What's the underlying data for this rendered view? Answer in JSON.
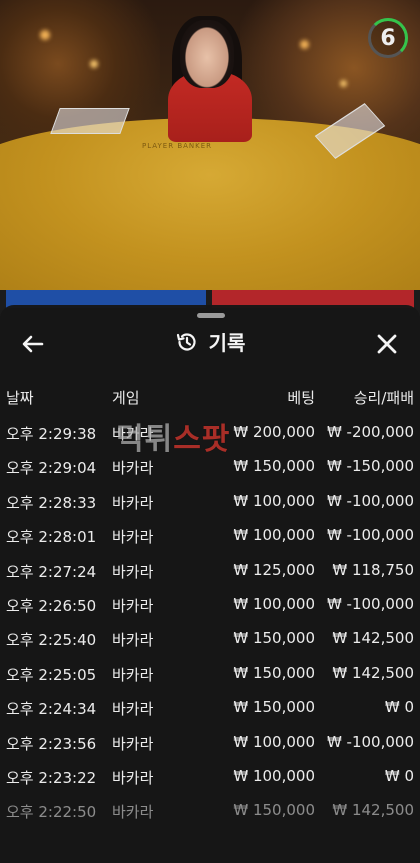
{
  "stream": {
    "countdown": "6",
    "table_labels": "PLAYER        BANKER"
  },
  "history": {
    "title": "기록",
    "columns": {
      "date": "날짜",
      "game": "게임",
      "bet": "베팅",
      "result": "승리/패배"
    },
    "rows": [
      {
        "time": "오후 2:29:38",
        "game": "바카라",
        "bet": "₩ 200,000",
        "result": "₩ -200,000"
      },
      {
        "time": "오후 2:29:04",
        "game": "바카라",
        "bet": "₩ 150,000",
        "result": "₩ -150,000"
      },
      {
        "time": "오후 2:28:33",
        "game": "바카라",
        "bet": "₩ 100,000",
        "result": "₩ -100,000"
      },
      {
        "time": "오후 2:28:01",
        "game": "바카라",
        "bet": "₩ 100,000",
        "result": "₩ -100,000"
      },
      {
        "time": "오후 2:27:24",
        "game": "바카라",
        "bet": "₩ 125,000",
        "result": "₩ 118,750"
      },
      {
        "time": "오후 2:26:50",
        "game": "바카라",
        "bet": "₩ 100,000",
        "result": "₩ -100,000"
      },
      {
        "time": "오후 2:25:40",
        "game": "바카라",
        "bet": "₩ 150,000",
        "result": "₩ 142,500"
      },
      {
        "time": "오후 2:25:05",
        "game": "바카라",
        "bet": "₩ 150,000",
        "result": "₩ 142,500"
      },
      {
        "time": "오후 2:24:34",
        "game": "바카라",
        "bet": "₩ 150,000",
        "result": "₩ 0"
      },
      {
        "time": "오후 2:23:56",
        "game": "바카라",
        "bet": "₩ 100,000",
        "result": "₩ -100,000"
      },
      {
        "time": "오후 2:23:22",
        "game": "바카라",
        "bet": "₩ 100,000",
        "result": "₩ 0"
      },
      {
        "time": "오후 2:22:50",
        "game": "바카라",
        "bet": "₩ 150,000",
        "result": "₩ 142,500"
      }
    ]
  },
  "watermark": {
    "part1": "먹튀",
    "part2": "스팟"
  },
  "icons": {
    "back": "arrow-left-icon",
    "close": "close-icon",
    "title": "history-icon"
  }
}
